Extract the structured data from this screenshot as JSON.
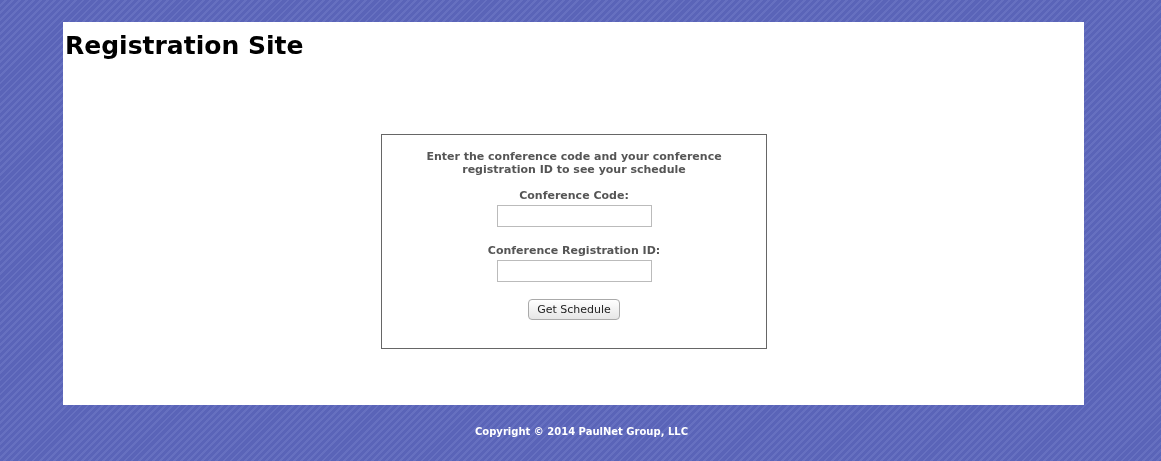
{
  "header": {
    "title": "Registration Site"
  },
  "form": {
    "instructions": "Enter the conference code and your conference registration ID to see your schedule",
    "fields": [
      {
        "label": "Conference Code:"
      },
      {
        "label": "Conference Registration ID:"
      }
    ],
    "button": "Get Schedule"
  },
  "footer": {
    "copyright": "Copyright © 2014 PaulNet Group, LLC"
  }
}
